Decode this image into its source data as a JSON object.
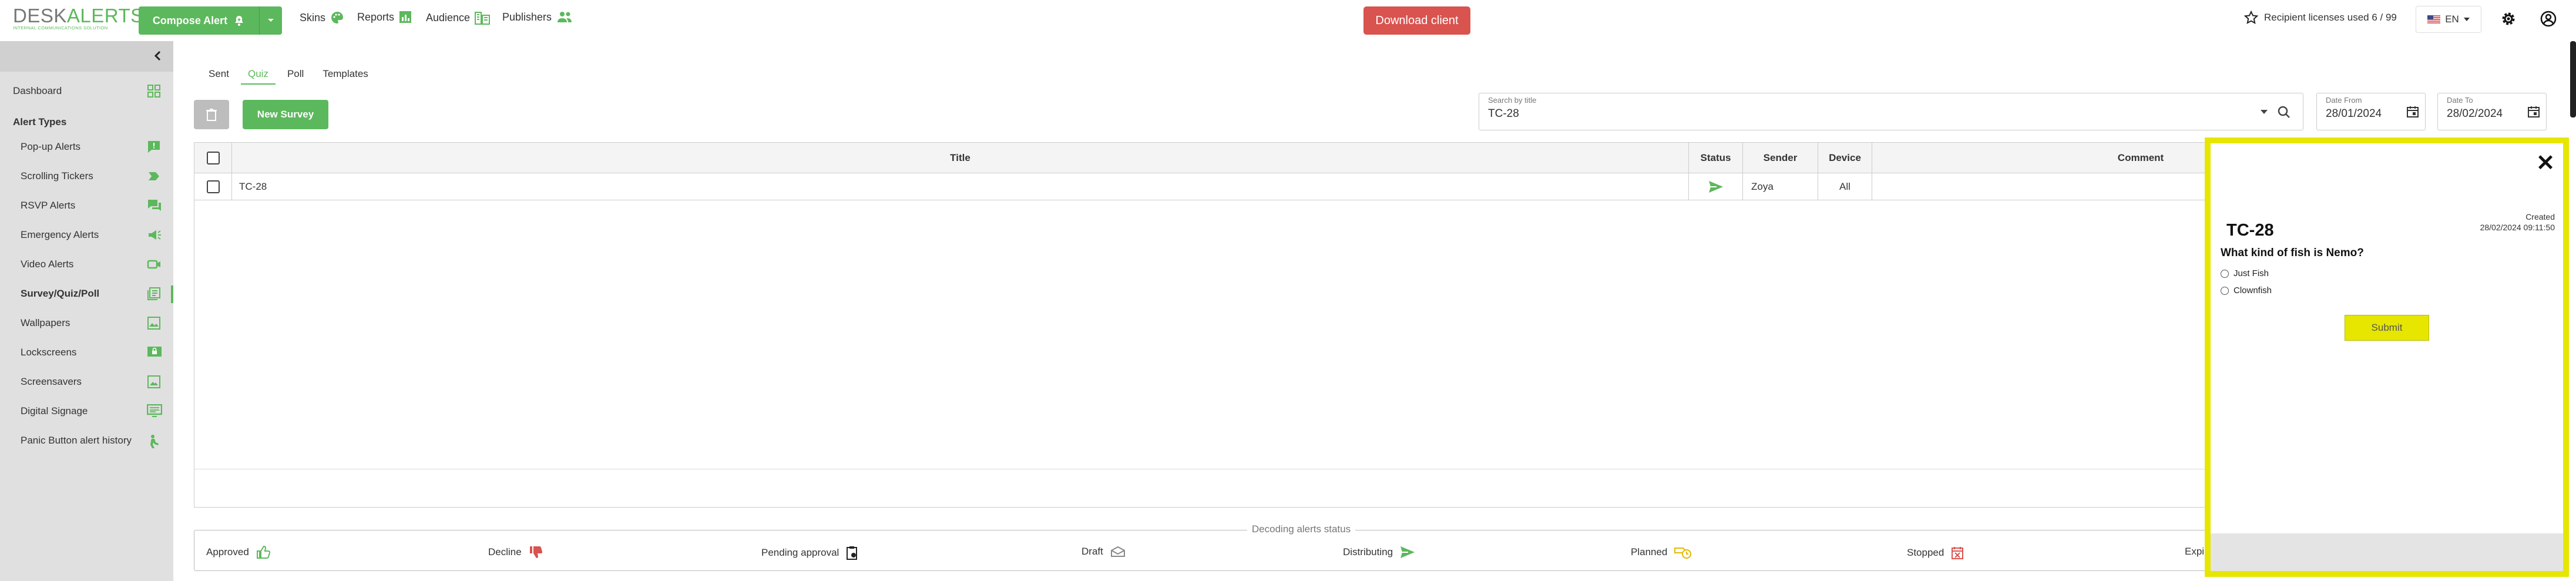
{
  "header": {
    "logo_main": "DESK",
    "logo_accent": "ALERTS",
    "logo_sub": "INTERNAL COMMUNICATIONS SOLUTION",
    "compose_label": "Compose Alert",
    "nav": [
      {
        "label": "Skins",
        "icon": "palette-icon"
      },
      {
        "label": "Reports",
        "icon": "chart-icon"
      },
      {
        "label": "Audience",
        "icon": "org-icon"
      },
      {
        "label": "Publishers",
        "icon": "people-icon"
      }
    ],
    "download_label": "Download client",
    "licenses_label": "Recipient licenses used 6 / 99",
    "language": "EN",
    "accent": "#5cb85c"
  },
  "sidebar": {
    "dashboard": "Dashboard",
    "section_title": "Alert Types",
    "items": [
      {
        "label": "Pop-up Alerts",
        "icon": "popup-icon"
      },
      {
        "label": "Scrolling Tickers",
        "icon": "ticker-icon"
      },
      {
        "label": "RSVP Alerts",
        "icon": "rsvp-icon"
      },
      {
        "label": "Emergency Alerts",
        "icon": "emergency-icon"
      },
      {
        "label": "Video Alerts",
        "icon": "video-icon"
      },
      {
        "label": "Survey/Quiz/Poll",
        "icon": "survey-icon",
        "active": true
      },
      {
        "label": "Wallpapers",
        "icon": "wallpaper-icon"
      },
      {
        "label": "Lockscreens",
        "icon": "lockscreen-icon"
      },
      {
        "label": "Screensavers",
        "icon": "screensaver-icon"
      },
      {
        "label": "Digital Signage",
        "icon": "signage-icon"
      },
      {
        "label": "Panic Button alert history",
        "icon": "panic-icon"
      }
    ]
  },
  "tabs": [
    {
      "label": "Sent",
      "active": false
    },
    {
      "label": "Quiz",
      "active": true
    },
    {
      "label": "Poll",
      "active": false
    },
    {
      "label": "Templates",
      "active": false
    }
  ],
  "toolbar": {
    "new_survey_label": "New Survey"
  },
  "filters": {
    "search_label": "Search by title",
    "search_value": "TC-28",
    "date_from_label": "Date From",
    "date_from_value": "28/01/2024",
    "date_to_label": "Date To",
    "date_to_value": "28/02/2024"
  },
  "table": {
    "columns": [
      "Title",
      "Status",
      "Sender",
      "Device",
      "Comment"
    ],
    "rows": [
      {
        "title": "TC-28",
        "status": "sent",
        "sender": "Zoya",
        "device": "All",
        "comment": ""
      }
    ]
  },
  "status_legend": {
    "title": "Decoding alerts status",
    "items": [
      {
        "label": "Approved",
        "icon": "thumbs-up-icon"
      },
      {
        "label": "Decline",
        "icon": "thumbs-down-icon"
      },
      {
        "label": "Pending approval",
        "icon": "clipboard-icon"
      },
      {
        "label": "Draft",
        "icon": "envelope-icon"
      },
      {
        "label": "Distributing",
        "icon": "send-icon"
      },
      {
        "label": "Planned",
        "icon": "planned-icon"
      },
      {
        "label": "Stopped",
        "icon": "stopped-icon"
      },
      {
        "label": "Expi",
        "icon": ""
      }
    ]
  },
  "preview": {
    "title": "TC-28",
    "created_label": "Created",
    "created_value": "28/02/2024 09:11:50",
    "question": "What kind of fish is Nemo?",
    "options": [
      "Just Fish",
      "Clownfish"
    ],
    "submit_label": "Submit",
    "highlight": "#e6e600"
  }
}
